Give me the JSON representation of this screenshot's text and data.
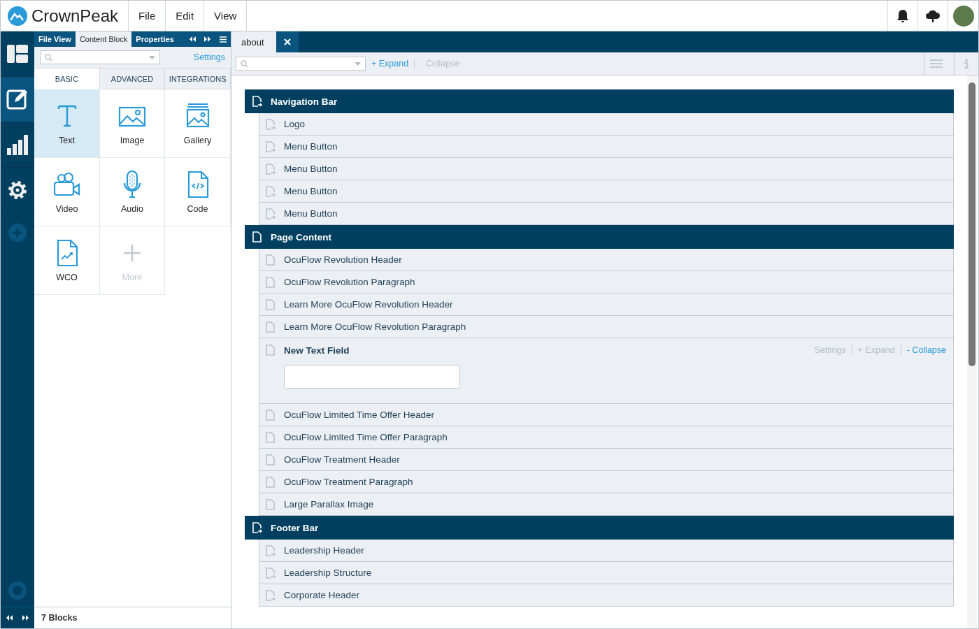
{
  "header": {
    "logo": "CrownPeak",
    "menu": [
      "File",
      "Edit",
      "View"
    ]
  },
  "rail": [
    {
      "kind": "layout",
      "selected": false
    },
    {
      "kind": "edit",
      "selected": true
    },
    {
      "kind": "chart",
      "selected": false
    },
    {
      "kind": "gear",
      "selected": false
    },
    {
      "kind": "add",
      "selected": false
    }
  ],
  "panel": {
    "tabs": [
      {
        "label": "File View",
        "selected": false
      },
      {
        "label": "Content Block",
        "selected": true
      },
      {
        "label": "Properties",
        "selected": false
      }
    ],
    "settings": "Settings",
    "subtabs": [
      {
        "label": "BASIC",
        "selected": true
      },
      {
        "label": "ADVANCED",
        "selected": false
      },
      {
        "label": "INTEGRATIONS",
        "selected": false
      }
    ],
    "blocks": [
      {
        "label": "Text",
        "kind": "text",
        "selected": true,
        "disabled": false
      },
      {
        "label": "Image",
        "kind": "image",
        "selected": false,
        "disabled": false
      },
      {
        "label": "Gallery",
        "kind": "gallery",
        "selected": false,
        "disabled": false
      },
      {
        "label": "Video",
        "kind": "video",
        "selected": false,
        "disabled": false
      },
      {
        "label": "Audio",
        "kind": "audio",
        "selected": false,
        "disabled": false
      },
      {
        "label": "Code",
        "kind": "code",
        "selected": false,
        "disabled": false
      },
      {
        "label": "WCO",
        "kind": "wco",
        "selected": false,
        "disabled": false
      },
      {
        "label": "More",
        "kind": "more",
        "selected": false,
        "disabled": true
      }
    ],
    "count": "7 Blocks"
  },
  "document": {
    "tab": "about",
    "expand": "+ Expand",
    "collapse": "- Collapse",
    "collapse_disabled": true,
    "sections": [
      {
        "title": "Navigation Bar",
        "linked": true,
        "items": [
          {
            "label": "Logo"
          },
          {
            "label": "Menu Button"
          },
          {
            "label": "Menu Button"
          },
          {
            "label": "Menu Button"
          },
          {
            "label": "Menu Button"
          }
        ]
      },
      {
        "title": "Page Content",
        "linked": false,
        "items": [
          {
            "label": "OcuFlow Revolution Header"
          },
          {
            "label": "OcuFlow Revolution Paragraph"
          },
          {
            "label": "Learn More OcuFlow Revolution Header"
          },
          {
            "label": "Learn More OcuFlow Revolution Paragraph"
          },
          {
            "label": "New Text Field",
            "expanded": true,
            "settings": "Settings",
            "expand": "+ Expand",
            "collapse": "- Collapse",
            "value": ""
          },
          {
            "label": "OcuFlow Limited Time Offer Header"
          },
          {
            "label": "OcuFlow Limited Time Offer Paragraph"
          },
          {
            "label": "OcuFlow Treatment Header"
          },
          {
            "label": "OcuFlow Treatment Paragraph"
          },
          {
            "label": "Large Parallax Image"
          }
        ]
      },
      {
        "title": "Footer Bar",
        "linked": true,
        "items": [
          {
            "label": "Leadership Header"
          },
          {
            "label": "Leadership Structure"
          },
          {
            "label": "Corporate Header"
          }
        ]
      }
    ]
  }
}
